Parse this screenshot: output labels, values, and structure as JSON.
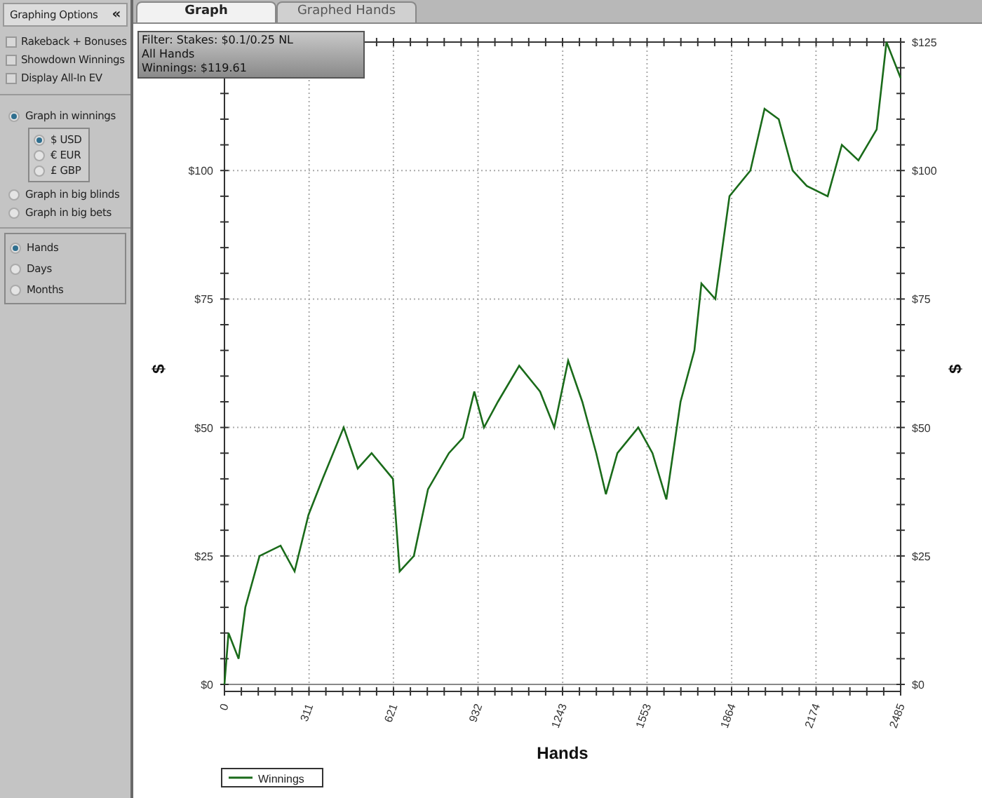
{
  "sidebar": {
    "title": "Graphing Options",
    "collapse": "«",
    "options": [
      {
        "label": "Rakeback + Bonuses",
        "checked": false
      },
      {
        "label": "Showdown Winnings",
        "checked": false
      },
      {
        "label": "Display All-In EV",
        "checked": false
      }
    ],
    "graph_modes": [
      {
        "label": "Graph in winnings",
        "selected": true
      },
      {
        "label": "Graph in big blinds",
        "selected": false
      },
      {
        "label": "Graph in big bets",
        "selected": false
      }
    ],
    "currencies": [
      {
        "label": "$ USD",
        "selected": true
      },
      {
        "label": "€ EUR",
        "selected": false
      },
      {
        "label": "£ GBP",
        "selected": false
      }
    ],
    "time_units": [
      {
        "label": "Hands",
        "selected": true
      },
      {
        "label": "Days",
        "selected": false
      },
      {
        "label": "Months",
        "selected": false
      }
    ]
  },
  "tabs": [
    {
      "label": "Graph",
      "selected": true
    },
    {
      "label": "Graphed Hands",
      "selected": false
    }
  ],
  "filter_box": [
    "Filter: Stakes: $0.1/0.25 NL",
    "All Hands",
    "Winnings: $119.61"
  ],
  "chart_data": {
    "type": "line",
    "xlabel": "Hands",
    "ylabel": "$",
    "x": [
      0,
      15,
      52,
      77,
      129,
      206,
      258,
      309,
      361,
      438,
      490,
      541,
      619,
      644,
      696,
      748,
      825,
      877,
      918,
      954,
      1005,
      1083,
      1160,
      1212,
      1263,
      1315,
      1366,
      1402,
      1444,
      1521,
      1573,
      1624,
      1676,
      1727,
      1753,
      1804,
      1856,
      1933,
      1985,
      2037,
      2088,
      2140,
      2217,
      2269,
      2330,
      2397,
      2433,
      2485
    ],
    "series": [
      {
        "name": "Winnings",
        "color": "#1a6b1a",
        "values": [
          0,
          10,
          5,
          15,
          25,
          27,
          22,
          33,
          40,
          50,
          42,
          45,
          40,
          22,
          25,
          38,
          45,
          48,
          57,
          50,
          55,
          62,
          57,
          50,
          63,
          55,
          45,
          37,
          45,
          50,
          45,
          36,
          55,
          65,
          78,
          75,
          95,
          100,
          112,
          110,
          100,
          97,
          95,
          105,
          102,
          108,
          125,
          118
        ]
      }
    ],
    "grid": true,
    "xlim": [
      0,
      2485
    ],
    "ylim": [
      0,
      125
    ],
    "xticks": [
      0,
      311,
      621,
      932,
      1243,
      1553,
      1864,
      2174,
      2485
    ],
    "yticks": [
      {
        "value": 0,
        "label": "$0"
      },
      {
        "value": 25,
        "label": "$25"
      },
      {
        "value": 50,
        "label": "$50"
      },
      {
        "value": 75,
        "label": "$75"
      },
      {
        "value": 100,
        "label": "$100"
      },
      {
        "value": 125,
        "label": "$125"
      }
    ]
  }
}
